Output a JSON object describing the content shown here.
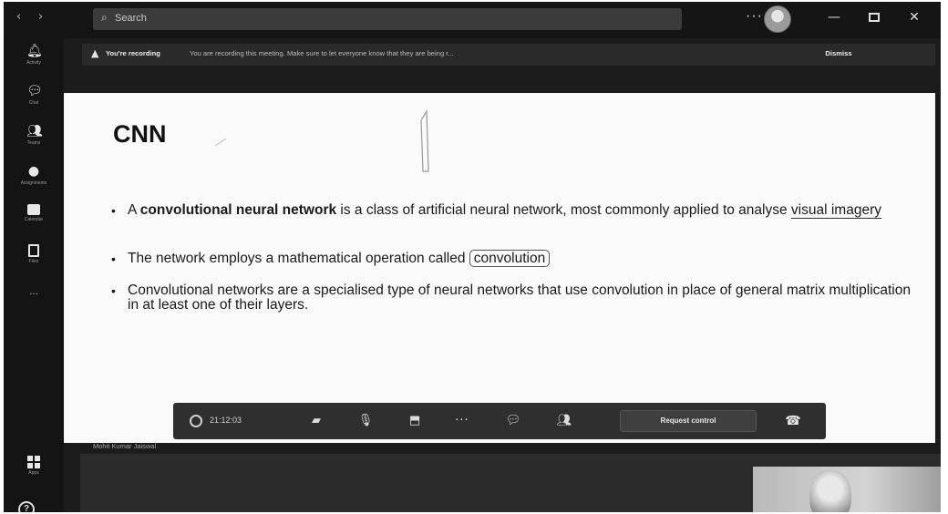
{
  "titlebar": {
    "back_glyph": "‹",
    "forward_glyph": "›",
    "search_placeholder": "Search",
    "more_glyph": "···",
    "minimize_glyph": "—",
    "close_glyph": "✕"
  },
  "sidebar": {
    "items": [
      {
        "icon": "bell-icon",
        "glyph": "🔔︎",
        "label": "Activity"
      },
      {
        "icon": "chat-icon",
        "glyph": "💬︎",
        "label": "Chat"
      },
      {
        "icon": "teams-icon",
        "glyph": "👥︎",
        "label": "Teams"
      },
      {
        "icon": "assignments-icon",
        "glyph": "●",
        "label": "Assignments"
      },
      {
        "icon": "calendar-icon",
        "glyph": "",
        "label": "Calendar"
      },
      {
        "icon": "files-icon",
        "glyph": "",
        "label": "Files"
      },
      {
        "icon": "more-apps-icon",
        "glyph": "···",
        "label": ""
      }
    ],
    "apps_label": "Apps",
    "help_glyph": "?"
  },
  "recording_banner": {
    "title": "You're recording",
    "message": "You are recording this meeting. Make sure to let everyone know that they are being r...",
    "dismiss_label": "Dismiss"
  },
  "slide": {
    "title": "CNN",
    "bullets": [
      {
        "before": "A ",
        "bold": "convolutional neural network",
        "after": " is a class of artificial neural network, most commonly applied to analyse ",
        "underlined": "visual imagery"
      },
      {
        "before": "The network employs a mathematical operation called ",
        "circled": "convolution"
      },
      {
        "text": "Convolutional networks are a specialised type of neural networks that use convolution in place of general matrix multiplication in at least one of their layers."
      }
    ],
    "bullet_glyph": "•"
  },
  "controls": {
    "timer": "21:12:03",
    "camera_glyph": "▰",
    "mic_glyph": "🎙︎",
    "share_glyph": "⬒",
    "more_glyph": "···",
    "chat_glyph": "💬︎",
    "people_glyph": "👥︎",
    "request_control_label": "Request control",
    "hangup_glyph": "☎︎"
  },
  "presenter_name": "Mohit Kumar Jaiswal"
}
